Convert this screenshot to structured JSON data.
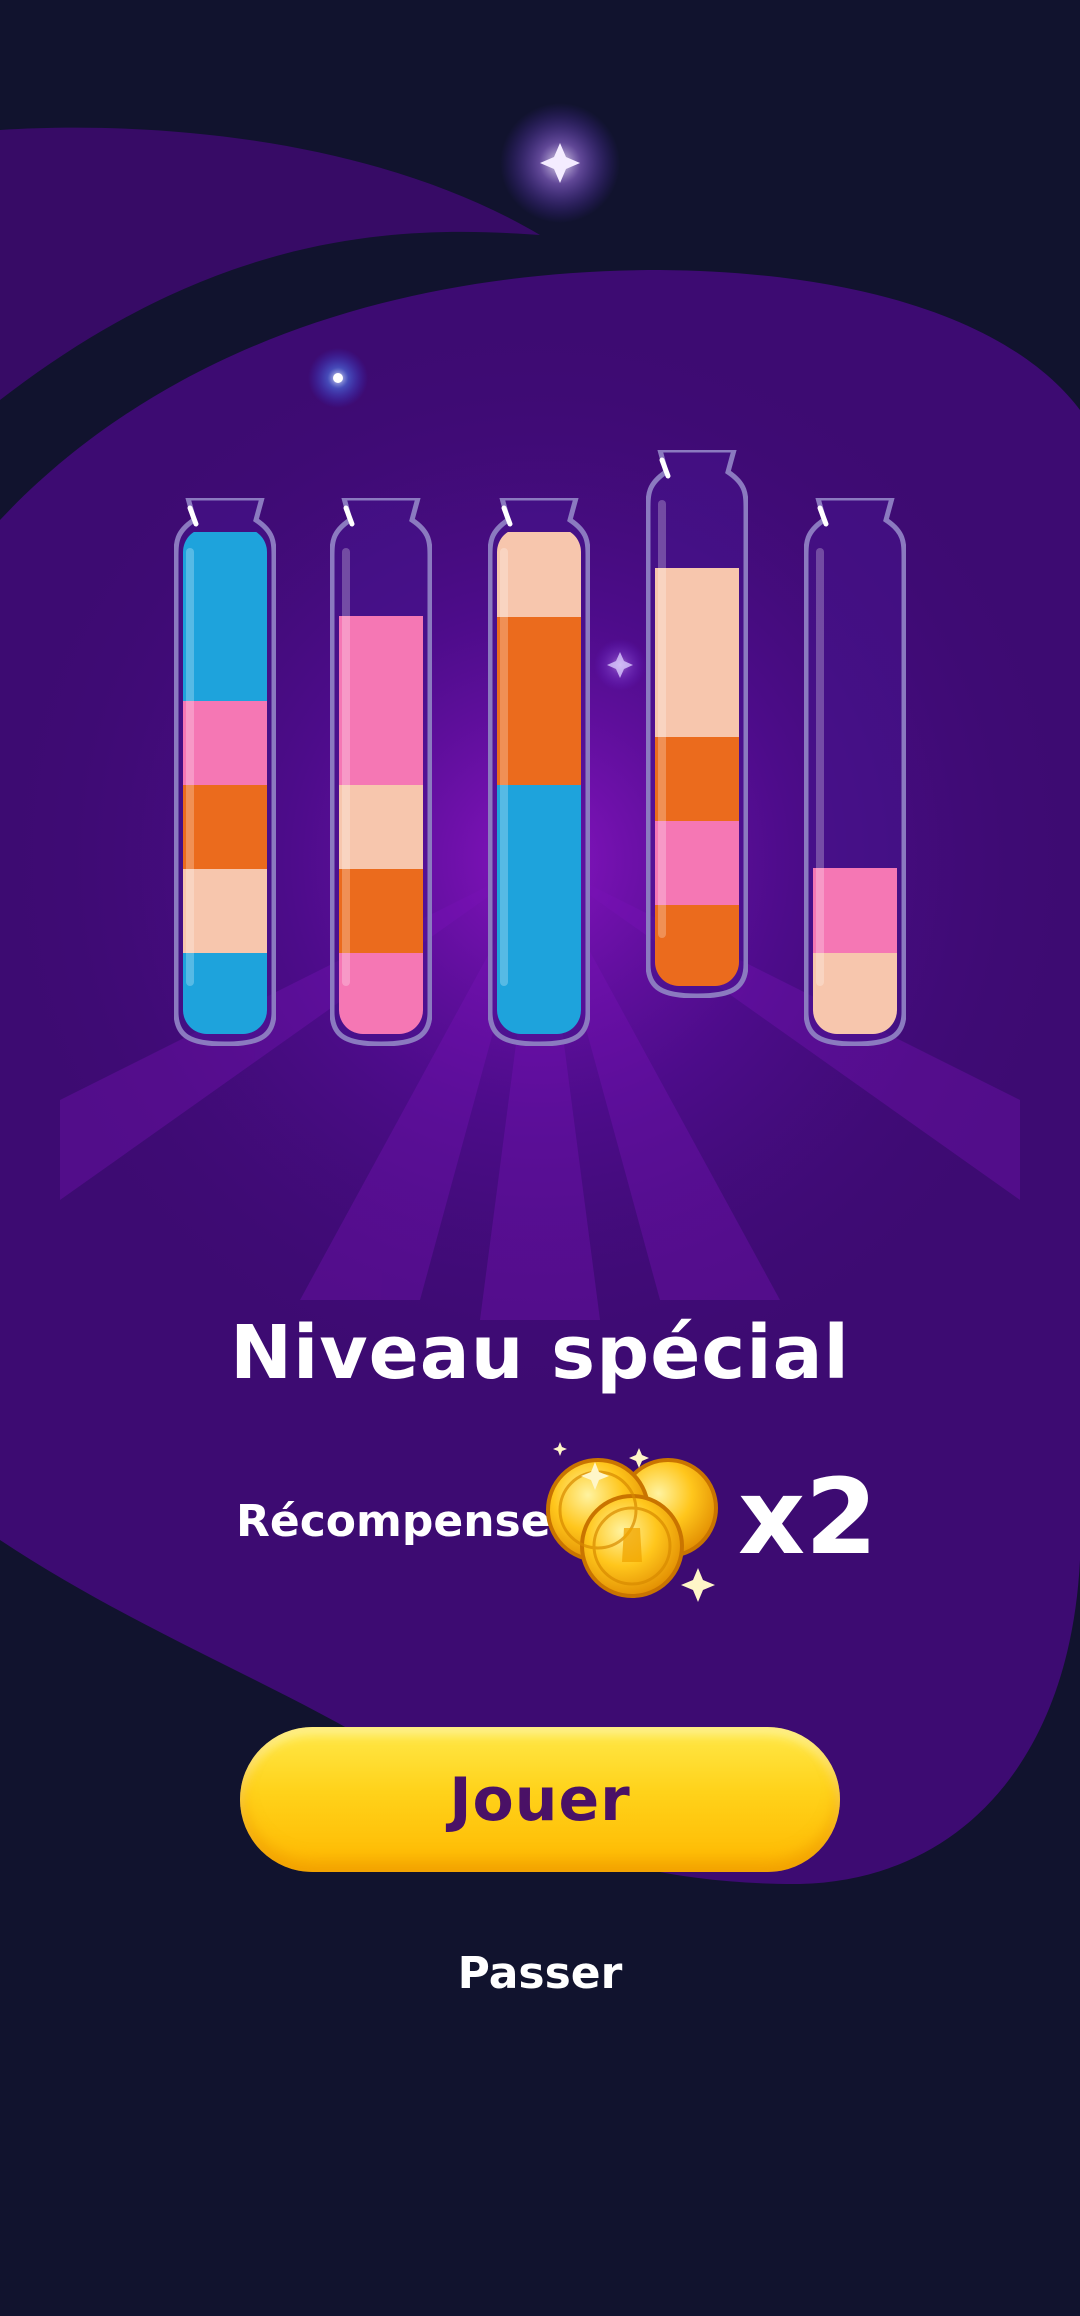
{
  "screen": {
    "title": "Niveau spécial",
    "reward_label": "Récompense",
    "reward_icon": "gold-coins-icon",
    "reward_multiplier": "x2",
    "play_button_label": "Jouer",
    "skip_label": "Passer"
  },
  "colors": {
    "blue": "#1ea3dc",
    "pink": "#f577b4",
    "orange": "#eb6b1d",
    "peach": "#f7c6ad",
    "button_yellow": "#ffd21a",
    "button_text": "#4a1166",
    "background": "#11132e",
    "blob_purple": "#3d0b72"
  },
  "tubes": [
    {
      "name": "tube-1",
      "capacity": 6,
      "layers": [
        "blue",
        "peach",
        "orange",
        "pink",
        "blue",
        "blue"
      ]
    },
    {
      "name": "tube-2",
      "capacity": 6,
      "layers": [
        "pink",
        "orange",
        "peach",
        "pink",
        "pink"
      ]
    },
    {
      "name": "tube-3",
      "capacity": 6,
      "layers": [
        "blue",
        "blue",
        "blue",
        "orange",
        "orange",
        "peach"
      ]
    },
    {
      "name": "tube-4",
      "capacity": 6,
      "layers": [
        "orange",
        "pink",
        "orange",
        "peach",
        "peach"
      ]
    },
    {
      "name": "tube-5",
      "capacity": 6,
      "layers": [
        "peach",
        "pink"
      ]
    }
  ]
}
